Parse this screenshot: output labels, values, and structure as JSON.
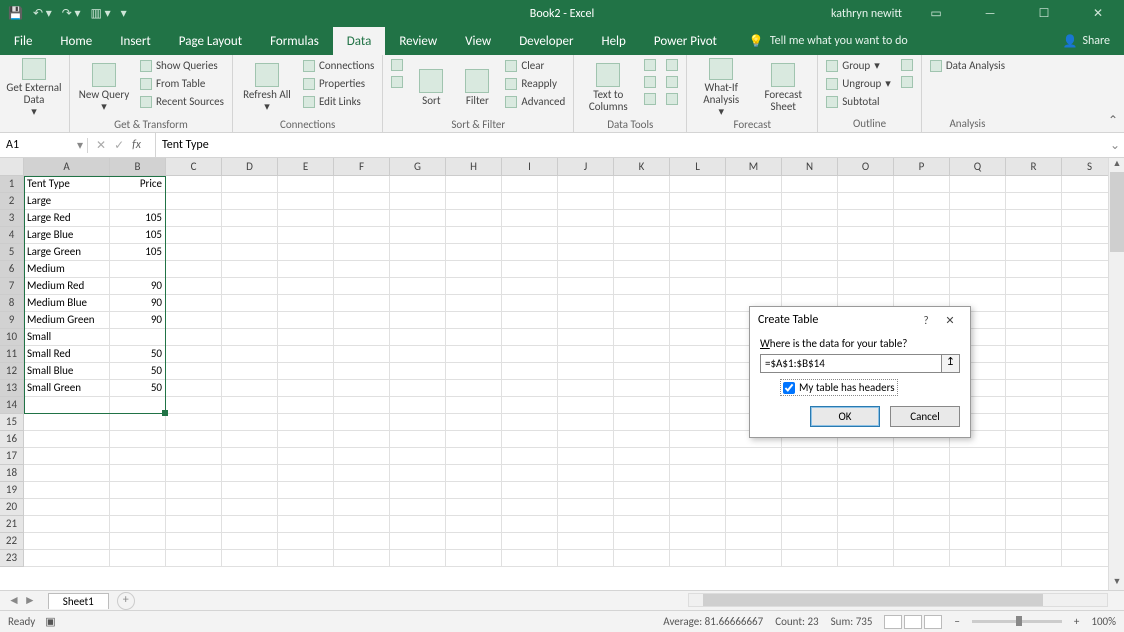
{
  "title": "Book2  -  Excel",
  "user": "kathryn newitt",
  "tabs": [
    "File",
    "Home",
    "Insert",
    "Page Layout",
    "Formulas",
    "Data",
    "Review",
    "View",
    "Developer",
    "Help",
    "Power Pivot"
  ],
  "active_tab": "Data",
  "tell_me": "Tell me what you want to do",
  "share": "Share",
  "ribbon_groups": {
    "get_transform": {
      "label": "Get & Transform",
      "ext_data": "Get External Data",
      "new_query": "New Query",
      "show_queries": "Show Queries",
      "from_table": "From Table",
      "recent_sources": "Recent Sources"
    },
    "connections": {
      "label": "Connections",
      "refresh": "Refresh All",
      "connections": "Connections",
      "properties": "Properties",
      "edit_links": "Edit Links"
    },
    "sort_filter": {
      "label": "Sort & Filter",
      "sort": "Sort",
      "filter": "Filter",
      "clear": "Clear",
      "reapply": "Reapply",
      "advanced": "Advanced"
    },
    "data_tools": {
      "label": "Data Tools",
      "ttc": "Text to Columns"
    },
    "forecast": {
      "label": "Forecast",
      "whatif": "What-If Analysis",
      "sheet": "Forecast Sheet"
    },
    "outline": {
      "label": "Outline",
      "group": "Group",
      "ungroup": "Ungroup",
      "subtotal": "Subtotal"
    },
    "analysis": {
      "label": "Analysis",
      "data_analysis": "Data Analysis"
    }
  },
  "name_box": "A1",
  "formula_text": "Tent Type",
  "columns": [
    "A",
    "B",
    "C",
    "D",
    "E",
    "F",
    "G",
    "H",
    "I",
    "J",
    "K",
    "L",
    "M",
    "N",
    "O",
    "P",
    "Q",
    "R",
    "S"
  ],
  "col_widths": {
    "A": 86,
    "B": 56,
    "default": 56
  },
  "row_count": 23,
  "data_rows": [
    [
      "Tent Type",
      "Price"
    ],
    [
      "Large",
      ""
    ],
    [
      "Large Red",
      "105"
    ],
    [
      "Large Blue",
      "105"
    ],
    [
      "Large Green",
      "105"
    ],
    [
      "Medium",
      ""
    ],
    [
      "Medium Red",
      "90"
    ],
    [
      "Medium Blue",
      "90"
    ],
    [
      "Medium Green",
      "90"
    ],
    [
      "Small",
      ""
    ],
    [
      "Small Red",
      "50"
    ],
    [
      "Small Blue",
      "50"
    ],
    [
      "Small Green",
      "50"
    ]
  ],
  "selection": {
    "range": "A1:B14",
    "rows": 14,
    "cols": 2
  },
  "sheet_tab": "Sheet1",
  "status": {
    "mode": "Ready",
    "average_label": "Average:",
    "average": "81.66666667",
    "count_label": "Count:",
    "count": "23",
    "sum_label": "Sum:",
    "sum": "735",
    "zoom": "100%"
  },
  "dialog": {
    "title": "Create Table",
    "prompt_pre": "W",
    "prompt_post": "here is the data for your table?",
    "range": "=$A$1:$B$14",
    "checkbox_pre": "M",
    "checkbox_post": "y table has headers",
    "checked": true,
    "ok": "OK",
    "cancel": "Cancel"
  }
}
